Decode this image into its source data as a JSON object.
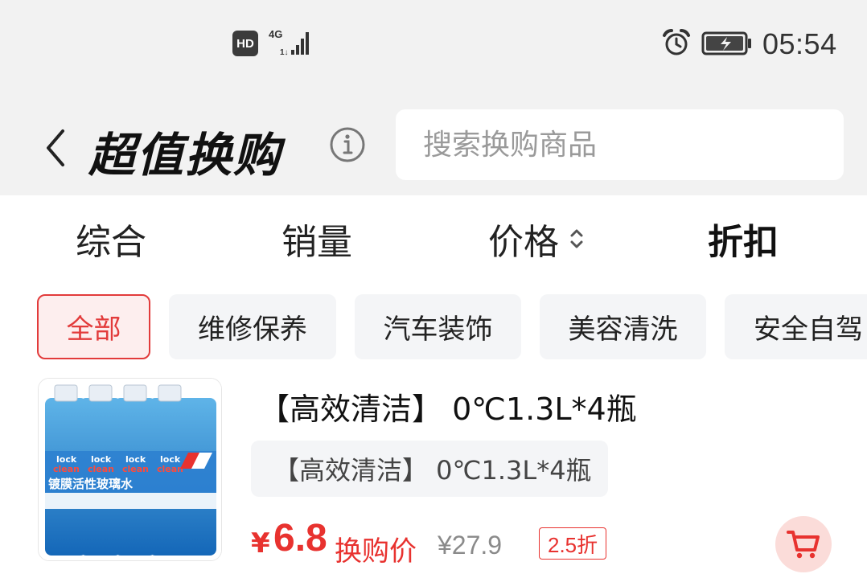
{
  "status_bar": {
    "hd_label": "HD",
    "network_label": "4G",
    "time": "05:54"
  },
  "header": {
    "title": "超值换购",
    "search_placeholder": "搜索换购商品"
  },
  "sort_tabs": [
    {
      "label": "综合"
    },
    {
      "label": "销量"
    },
    {
      "label": "价格"
    },
    {
      "label": "折扣"
    }
  ],
  "categories": [
    {
      "label": "全部"
    },
    {
      "label": "维修保养"
    },
    {
      "label": "汽车装饰"
    },
    {
      "label": "美容清洗"
    },
    {
      "label": "安全自驾"
    }
  ],
  "product": {
    "title": "【高效清洁】 0℃1.3L*4瓶",
    "tag": "【高效清洁】 0℃1.3L*4瓶",
    "price_symbol": "¥",
    "price": "6.8",
    "price_label": "换购价",
    "original_price": "¥27.9",
    "discount": "2.5折",
    "image_brand_line1": "lock",
    "image_brand_line2": "clean",
    "image_text": "镀膜活性玻璃水"
  },
  "colors": {
    "accent": "#e8322f",
    "header_bg": "#f2f2f2",
    "chip_bg": "#f4f5f7"
  }
}
